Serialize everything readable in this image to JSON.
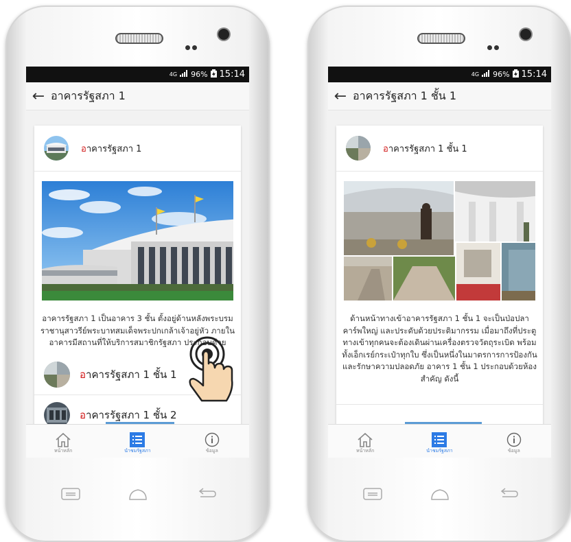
{
  "screens": [
    {
      "status": {
        "network": "4G",
        "battery": "96%",
        "time": "15:14"
      },
      "appbar": {
        "title": "อาคารรัฐสภา 1"
      },
      "card": {
        "header_initial": "อ",
        "header_rest": "าคารรัฐสภา 1",
        "description": "อาคารรัฐสภา 1 เป็นอาคาร 3 ชั้น ตั้งอยู่ด้านหลังพระบรมราชานุสาวรีย์พระบาทสมเด็จพระปกเกล้าเจ้าอยู่หัว ภายในอาคารมีสถานที่ให้บริการสมาชิกรัฐสภา ประกอบด้วย",
        "items": [
          {
            "initial": "อ",
            "rest": "าคารรัฐสภา 1 ชั้น 1"
          },
          {
            "initial": "อ",
            "rest": "าคารรัฐสภา 1 ชั้น 2"
          }
        ]
      },
      "nav": [
        {
          "label": "หน้าหลัก",
          "icon": "home-icon"
        },
        {
          "label": "นำชมรัฐสภา",
          "icon": "list-icon"
        },
        {
          "label": "ข้อมูล",
          "icon": "info-icon"
        }
      ],
      "active_nav": 1
    },
    {
      "status": {
        "network": "4G",
        "battery": "96%",
        "time": "15:14"
      },
      "appbar": {
        "title": "อาคารรัฐสภา 1 ชั้น 1"
      },
      "card": {
        "header_initial": "อ",
        "header_rest": "าคารรัฐสภา 1 ชั้น 1",
        "description": "ด้านหน้าทางเข้าอาคารรัฐสภา 1 ชั้น 1 จะเป็นป่อปลาคาร์พใหญ่ และประดับด้วยประติมากรรม เมื่อมาถึงที่ประตูทางเข้าทุกคนจะต้องเดินผ่านเครื่องตรวจวัตถุระเบิด พร้อมทั้งเอ็กเรย์กระเป๋าทุกใบ ซึ่งเป็นหนึ่งในมาตรการการป้องกันและรักษาความปลอดภัย อาคาร 1 ชั้น 1 ประกอบด้วยห้องสำคัญ ดังนี้"
      },
      "nav": [
        {
          "label": "หน้าหลัก",
          "icon": "home-icon"
        },
        {
          "label": "นำชมรัฐสภา",
          "icon": "list-icon"
        },
        {
          "label": "ข้อมูล",
          "icon": "info-icon"
        }
      ],
      "active_nav": 1
    }
  ],
  "colors": {
    "accent": "#2c7be5",
    "highlight": "#d11717",
    "statusbar": "#111111"
  }
}
